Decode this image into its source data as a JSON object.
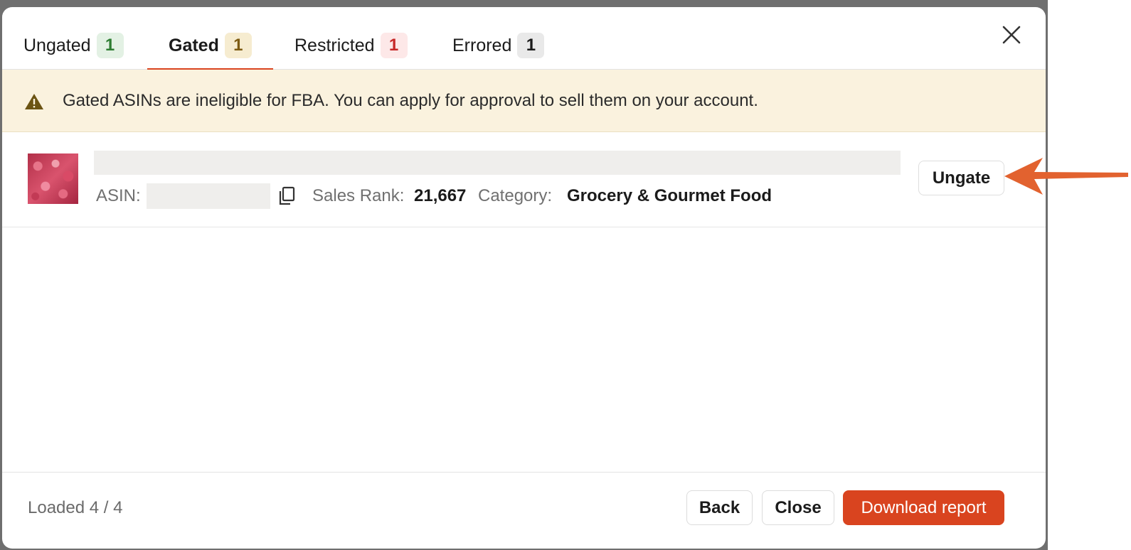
{
  "tabs": [
    {
      "label": "Ungated",
      "count": "1",
      "badge_color": "#2e7d32"
    },
    {
      "label": "Gated",
      "count": "1",
      "badge_color": "#7d5b12",
      "active": true
    },
    {
      "label": "Restricted",
      "count": "1",
      "badge_color": "#c62828"
    },
    {
      "label": "Errored",
      "count": "1",
      "badge_color": "#1b1b1b"
    }
  ],
  "close_icon": "close-icon",
  "banner": {
    "icon": "warning-icon",
    "text": "Gated ASINs are ineligible for FBA. You can apply for approval to sell them on your account."
  },
  "product": {
    "asin_label": "ASIN:",
    "copy_icon": "copy-icon",
    "sales_rank_label": "Sales Rank:",
    "sales_rank_value": "21,667",
    "category_label": "Category:",
    "category_value": "Grocery & Gourmet Food",
    "ungate_label": "Ungate"
  },
  "footer": {
    "loaded_text": "Loaded 4 / 4",
    "back_label": "Back",
    "close_label": "Close",
    "download_label": "Download report"
  },
  "colors": {
    "accent": "#d9441f",
    "banner_bg": "#faf2de"
  }
}
